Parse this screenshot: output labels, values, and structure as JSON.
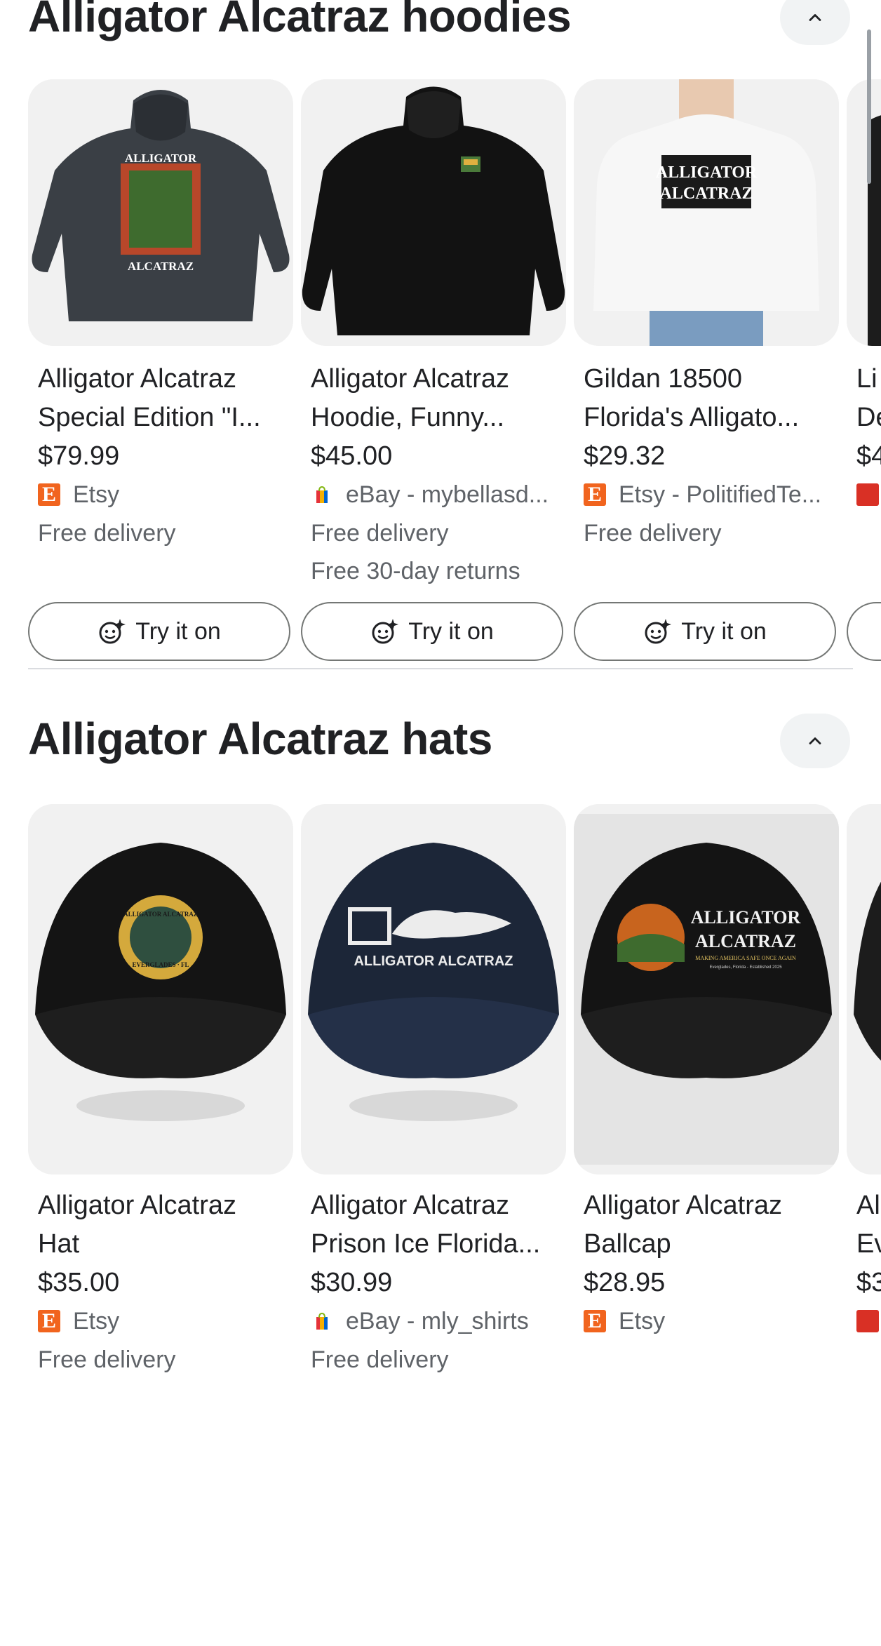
{
  "sections": [
    {
      "title": "Alligator Alcatraz hoodies",
      "products": [
        {
          "title_line1": "Alligator Alcatraz",
          "title_line2": "Special Edition \"I...",
          "price": "$79.99",
          "seller": "Etsy",
          "seller_icon": "etsy-logo-icon",
          "delivery": "Free delivery",
          "returns": "",
          "try_on": "Try it on",
          "image_text": [
            "ALLIGATOR",
            "ALCATRAZ"
          ],
          "image_color": "#3a3f45"
        },
        {
          "title_line1": "Alligator Alcatraz",
          "title_line2": "Hoodie, Funny...",
          "price": "$45.00",
          "seller": "eBay - mybellasd...",
          "seller_icon": "ebay-logo-icon",
          "delivery": "Free delivery",
          "returns": "Free 30-day returns",
          "try_on": "Try it on",
          "image_text": [],
          "image_color": "#121212"
        },
        {
          "title_line1": "Gildan 18500",
          "title_line2": "Florida's Alligato...",
          "price": "$29.32",
          "seller": "Etsy - PolitifiedTe...",
          "seller_icon": "etsy-logo-icon",
          "delivery": "Free delivery",
          "returns": "",
          "try_on": "Try it on",
          "image_text": [
            "ALLIGATOR",
            "ALCATRAZ"
          ],
          "image_color": "#f7f7f7"
        },
        {
          "title_line1": "Li",
          "title_line2": "De",
          "price": "$4",
          "seller": "",
          "seller_icon": "store-logo-icon",
          "delivery": "",
          "returns": "",
          "try_on": "",
          "image_text": [],
          "image_color": "#1c1c1c"
        }
      ]
    },
    {
      "title": "Alligator Alcatraz hats",
      "products": [
        {
          "title_line1": "Alligator Alcatraz",
          "title_line2": "Hat",
          "price": "$35.00",
          "seller": "Etsy",
          "seller_icon": "etsy-logo-icon",
          "delivery": "Free delivery",
          "image_text": [
            "ALLIGATOR ALCATRAZ",
            "EVERGLADES · FL"
          ],
          "image_color": "#141414"
        },
        {
          "title_line1": "Alligator Alcatraz",
          "title_line2": "Prison Ice Florida...",
          "price": "$30.99",
          "seller": "eBay - mly_shirts",
          "seller_icon": "ebay-logo-icon",
          "delivery": "Free delivery",
          "image_text": [
            "ALLIGATOR ALCATRAZ"
          ],
          "image_color": "#1c2638"
        },
        {
          "title_line1": "Alligator Alcatraz",
          "title_line2": "Ballcap",
          "price": "$28.95",
          "seller": "Etsy",
          "seller_icon": "etsy-logo-icon",
          "delivery": "",
          "image_text": [
            "ALLIGATOR",
            "ALCATRAZ",
            "MAKING AMERICA SAFE ONCE AGAIN",
            "Everglades, Florida - Established 2025"
          ],
          "image_color": "#141414"
        },
        {
          "title_line1": "Al",
          "title_line2": "Ev",
          "price": "$3",
          "seller": "",
          "seller_icon": "store-logo-icon",
          "delivery": "",
          "image_text": [],
          "image_color": "#1c1c1c"
        }
      ]
    }
  ],
  "colors": {
    "etsy": "#f1641e",
    "chip_bg": "#f1f3f4",
    "secondary_text": "#5f6368"
  }
}
